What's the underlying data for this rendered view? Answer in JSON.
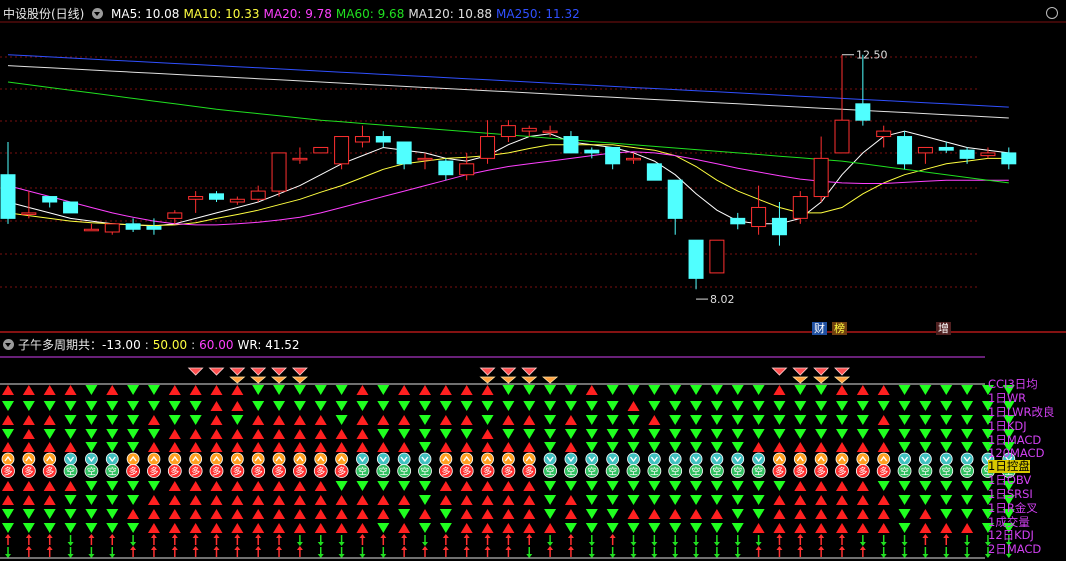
{
  "main_pane": {
    "title": "中设股份(日线)",
    "ma_labels": [
      {
        "text": "MA5: 10.08",
        "color": "#ffffff"
      },
      {
        "text": "MA10: 10.33",
        "color": "#ffff40"
      },
      {
        "text": "MA20: 9.78",
        "color": "#ff40ff"
      },
      {
        "text": "MA60: 9.68",
        "color": "#20e020"
      },
      {
        "text": "MA120: 10.88",
        "color": "#e0e0e0"
      },
      {
        "text": "MA250: 11.32",
        "color": "#3050ff"
      }
    ],
    "high_label": "12.50",
    "low_label": "8.02",
    "event_tags": [
      {
        "text": "财",
        "bg": "#2050a0",
        "color": "#ffffff"
      },
      {
        "text": "榜",
        "bg": "#704010",
        "color": "#ffff40"
      },
      {
        "text": "增",
        "bg": "#502020",
        "color": "#ffffff"
      }
    ]
  },
  "sub_pane": {
    "title": "子午多周期共：",
    "values": [
      {
        "text": "-13.00",
        "color": "#ffffff"
      },
      {
        "text": "50.00",
        "color": "#ffff40"
      },
      {
        "text": "60.00",
        "color": "#ff40ff"
      },
      {
        "text": "WR: 41.52",
        "color": "#ffffff"
      }
    ],
    "row_labels": [
      "CCI3日均",
      "1日WR",
      "1日LWR改良",
      "1日KDJ",
      "1日MACD",
      "120MACD",
      "1日控盘",
      "1日OBV",
      "1日SRSI",
      "1日R金叉",
      "1成交量",
      "12日KDJ",
      "2日MACD"
    ],
    "selected_row": 6,
    "badge_up": "多",
    "badge_down": "空"
  },
  "colors": {
    "up": "#ff3030",
    "down": "#50ffff",
    "ma5": "#ffffff",
    "ma10": "#ffff40",
    "ma20": "#ff40ff",
    "ma60": "#20e020",
    "ma120": "#e0e0e0",
    "ma250": "#3050ff"
  },
  "chart_data": {
    "type": "candlestick",
    "ylim": [
      7.6,
      13.1
    ],
    "candles": [
      [
        10.3,
        10.9,
        9.5,
        9.4
      ],
      [
        9.6,
        10.0,
        9.6,
        9.5
      ],
      [
        9.9,
        9.9,
        9.8,
        9.7
      ],
      [
        9.8,
        9.8,
        9.6,
        9.6
      ],
      [
        9.3,
        9.4,
        9.3,
        9.3
      ],
      [
        9.25,
        9.4,
        9.4,
        9.2
      ],
      [
        9.4,
        9.5,
        9.3,
        9.25
      ],
      [
        9.35,
        9.5,
        9.3,
        9.2
      ],
      [
        9.5,
        9.65,
        9.6,
        9.4
      ],
      [
        9.85,
        10.0,
        9.9,
        9.6
      ],
      [
        9.95,
        10.0,
        9.85,
        9.8
      ],
      [
        9.8,
        9.9,
        9.85,
        9.75
      ],
      [
        9.85,
        10.1,
        10.0,
        9.8
      ],
      [
        10.0,
        10.7,
        10.7,
        9.9
      ],
      [
        10.6,
        10.8,
        10.6,
        10.5
      ],
      [
        10.7,
        10.8,
        10.8,
        10.7
      ],
      [
        10.5,
        11.0,
        11.0,
        10.4
      ],
      [
        10.9,
        11.2,
        11.0,
        10.8
      ],
      [
        11.0,
        11.1,
        10.9,
        10.8
      ],
      [
        10.9,
        10.9,
        10.5,
        10.4
      ],
      [
        10.6,
        10.7,
        10.6,
        10.4
      ],
      [
        10.55,
        10.6,
        10.3,
        10.2
      ],
      [
        10.3,
        10.7,
        10.5,
        10.2
      ],
      [
        10.6,
        11.3,
        11.0,
        10.5
      ],
      [
        11.0,
        11.3,
        11.2,
        10.9
      ],
      [
        11.1,
        11.2,
        11.15,
        11.0
      ],
      [
        11.1,
        11.2,
        11.1,
        11.0
      ],
      [
        11.0,
        11.1,
        10.7,
        10.7
      ],
      [
        10.75,
        10.8,
        10.7,
        10.6
      ],
      [
        10.8,
        10.8,
        10.5,
        10.4
      ],
      [
        10.6,
        10.7,
        10.6,
        10.5
      ],
      [
        10.5,
        10.5,
        10.2,
        10.2
      ],
      [
        10.2,
        10.2,
        9.5,
        9.2
      ],
      [
        9.1,
        9.1,
        8.4,
        8.2
      ],
      [
        8.5,
        9.1,
        9.1,
        8.5
      ],
      [
        9.5,
        9.6,
        9.4,
        9.3
      ],
      [
        9.35,
        10.1,
        9.7,
        9.2
      ],
      [
        9.5,
        9.8,
        9.2,
        9.0
      ],
      [
        9.5,
        10.0,
        9.9,
        9.4
      ],
      [
        9.9,
        11.0,
        10.6,
        9.8
      ],
      [
        10.7,
        12.5,
        11.3,
        10.7
      ],
      [
        11.6,
        12.5,
        11.3,
        11.2
      ],
      [
        11.0,
        11.2,
        11.1,
        10.8
      ],
      [
        11.0,
        11.1,
        10.5,
        10.4
      ],
      [
        10.7,
        10.8,
        10.8,
        10.5
      ],
      [
        10.8,
        10.9,
        10.75,
        10.7
      ],
      [
        10.75,
        10.8,
        10.6,
        10.5
      ],
      [
        10.65,
        10.8,
        10.7,
        10.6
      ],
      [
        10.7,
        10.8,
        10.5,
        10.4
      ]
    ],
    "series": [
      {
        "name": "MA5",
        "values": [
          9.8,
          9.7,
          9.6,
          9.5,
          9.45,
          9.4,
          9.38,
          9.36,
          9.4,
          9.5,
          9.6,
          9.7,
          9.8,
          9.95,
          10.1,
          10.3,
          10.5,
          10.65,
          10.8,
          10.75,
          10.7,
          10.6,
          10.55,
          10.65,
          10.85,
          11.0,
          11.05,
          10.9,
          10.85,
          10.8,
          10.7,
          10.55,
          10.3,
          9.95,
          9.65,
          9.45,
          9.4,
          9.4,
          9.5,
          9.8,
          10.3,
          10.7,
          11.0,
          11.1,
          11.0,
          10.9,
          10.8,
          10.75,
          10.7
        ]
      },
      {
        "name": "MA10",
        "values": [
          9.6,
          9.55,
          9.5,
          9.45,
          9.42,
          9.4,
          9.38,
          9.37,
          9.38,
          9.42,
          9.5,
          9.57,
          9.65,
          9.75,
          9.85,
          9.98,
          10.1,
          10.25,
          10.4,
          10.5,
          10.55,
          10.6,
          10.62,
          10.65,
          10.7,
          10.78,
          10.85,
          10.85,
          10.85,
          10.85,
          10.8,
          10.75,
          10.65,
          10.45,
          10.2,
          10.0,
          9.85,
          9.7,
          9.6,
          9.6,
          9.7,
          9.95,
          10.15,
          10.3,
          10.4,
          10.5,
          10.55,
          10.6,
          10.6
        ]
      },
      {
        "name": "MA20",
        "values": [
          10.1,
          10.0,
          9.9,
          9.8,
          9.7,
          9.6,
          9.52,
          9.45,
          9.4,
          9.38,
          9.38,
          9.4,
          9.43,
          9.47,
          9.52,
          9.6,
          9.7,
          9.8,
          9.9,
          10.0,
          10.1,
          10.2,
          10.3,
          10.38,
          10.45,
          10.5,
          10.55,
          10.6,
          10.65,
          10.7,
          10.72,
          10.7,
          10.65,
          10.58,
          10.5,
          10.42,
          10.35,
          10.28,
          10.22,
          10.18,
          10.15,
          10.14,
          10.14,
          10.16,
          10.18,
          10.2,
          10.2,
          10.2,
          10.2
        ]
      },
      {
        "name": "MA60",
        "values": [
          12.0,
          11.95,
          11.9,
          11.85,
          11.8,
          11.75,
          11.7,
          11.65,
          11.6,
          11.55,
          11.5,
          11.46,
          11.42,
          11.38,
          11.34,
          11.3,
          11.27,
          11.24,
          11.21,
          11.18,
          11.15,
          11.12,
          11.09,
          11.06,
          11.03,
          11.0,
          10.97,
          10.94,
          10.91,
          10.88,
          10.85,
          10.82,
          10.79,
          10.76,
          10.73,
          10.7,
          10.67,
          10.64,
          10.61,
          10.58,
          10.55,
          10.5,
          10.45,
          10.4,
          10.35,
          10.3,
          10.25,
          10.2,
          10.15
        ]
      },
      {
        "name": "MA120",
        "values": [
          12.3,
          12.28,
          12.26,
          12.24,
          12.22,
          12.2,
          12.18,
          12.16,
          12.14,
          12.12,
          12.1,
          12.08,
          12.06,
          12.04,
          12.02,
          12.0,
          11.98,
          11.96,
          11.94,
          11.92,
          11.9,
          11.88,
          11.86,
          11.84,
          11.82,
          11.8,
          11.78,
          11.76,
          11.74,
          11.72,
          11.7,
          11.68,
          11.66,
          11.64,
          11.62,
          11.6,
          11.58,
          11.56,
          11.54,
          11.52,
          11.5,
          11.48,
          11.46,
          11.44,
          11.42,
          11.4,
          11.38,
          11.36,
          11.34
        ]
      },
      {
        "name": "MA250",
        "values": [
          12.5,
          12.48,
          12.46,
          12.44,
          12.42,
          12.4,
          12.38,
          12.36,
          12.34,
          12.32,
          12.3,
          12.28,
          12.26,
          12.24,
          12.22,
          12.2,
          12.18,
          12.16,
          12.14,
          12.12,
          12.1,
          12.08,
          12.06,
          12.04,
          12.02,
          12.0,
          11.98,
          11.96,
          11.94,
          11.92,
          11.9,
          11.88,
          11.86,
          11.84,
          11.82,
          11.8,
          11.78,
          11.76,
          11.74,
          11.72,
          11.7,
          11.68,
          11.66,
          11.64,
          11.62,
          11.6,
          11.58,
          11.56,
          11.54
        ]
      }
    ],
    "signals": {
      "gem_top": "0000000001111110000000011100000000000111100000000",
      "gem_bottom": "0000000000011110000000011110000000000011100000000",
      "rows": [
        "UUUUDUDDUUUUDDDDDUDUUUUUDDDDUDDDDDDDDUDDUUUDDDDDD",
        "DDDDDDDDDDUUDDDDDDDDDDDDDDDDDDUDDDDDDDDDDDDDDDDDD",
        "UUUDDDDUDDUDUUUUDUUUDUUDUUDUDDDUDDDDDDDDDDUDDDDDD",
        "DUDDDDDDUUUUUUUUUUDDDDDUDDDDDDDDDDDDDDDDDDDDDDDDD",
        "UUUUDDDUUUUUUUUUUUUUDUUUUUDUDDDDDDDDUUUUUUUDDDDDD",
        "UUUDDDUUUUUUUUUUUDDDDUUUUUDDDDDDDDDDDUUUUUUDDDDDD",
        "UUUDDDUUUUUUUUUUUDDDDUUUUUDDDDDDDDDDDUUUUUUDDDDDD",
        "UUUUDDDDUUUUUUUUDDDDDUUUUUDDDDDDDDDDDDUUUUDDDDDDD",
        "UUUDDDDUUUUUUUUUUUUUDUUUUUDUDDDDDDDDDUUUUUUDDDDDD",
        "DDDDDDUUUUUUUUUUUUUDUDUUUUDUDDUUUUUDDUUUUUUDUDDDD",
        "DDDDDDDUUUUUUUUUUUDUDDUUUUUDDDDDDDDDUUUUUUUDUUUDD",
        "UUUDUUDUUUUUUUDDDUUUDUUUUUDUDUDDDDDDDUUUUDDDUUDDD",
        "DUUDDDUUUUUUUUUDDDDUUUUUUDUUDDDDDDDDUUUUUUDDDDDDD"
      ]
    }
  }
}
